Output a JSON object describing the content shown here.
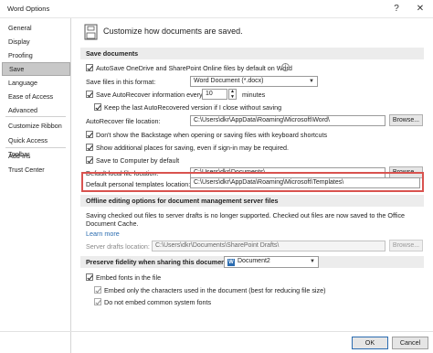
{
  "window": {
    "title": "Word Options",
    "help": "?",
    "close": "✕"
  },
  "sidebar": {
    "items": [
      {
        "label": "General"
      },
      {
        "label": "Display"
      },
      {
        "label": "Proofing"
      },
      {
        "label": "Save",
        "selected": true
      },
      {
        "label": "Language"
      },
      {
        "label": "Ease of Access"
      },
      {
        "label": "Advanced"
      },
      {
        "label": "Customize Ribbon"
      },
      {
        "label": "Quick Access Toolbar"
      },
      {
        "label": "Add-ins"
      },
      {
        "label": "Trust Center"
      }
    ]
  },
  "header": {
    "text": "Customize how documents are saved."
  },
  "save_documents": {
    "heading": "Save documents",
    "autosave": {
      "label": "AutoSave OneDrive and SharePoint Online files by default on Word",
      "checked": true
    },
    "format_label": "Save files in this format:",
    "format_value": "Word Document (*.docx)",
    "autorecover": {
      "label": "Save AutoRecover information every",
      "checked": true,
      "minutes": "10",
      "unit": "minutes"
    },
    "keep_last": {
      "label": "Keep the last AutoRecovered version if I close without saving",
      "checked": true
    },
    "autorecover_location_label": "AutoRecover file location:",
    "autorecover_location_value": "C:\\Users\\dkr\\AppData\\Roaming\\Microsoft\\Word\\",
    "browse_label": "Browse...",
    "backstage": {
      "label": "Don't show the Backstage when opening or saving files with keyboard shortcuts",
      "checked": true
    },
    "additional_places": {
      "label": "Show additional places for saving, even if sign-in may be required.",
      "checked": true
    },
    "save_to_computer": {
      "label": "Save to Computer by default",
      "checked": true
    },
    "default_local_label": "Default local file location:",
    "default_local_value": "C:\\Users\\dkr\\Documents\\",
    "default_templates_label": "Default personal templates location:",
    "default_templates_value": "C:\\Users\\dkr\\AppData\\Roaming\\Microsoft\\Templates\\"
  },
  "offline": {
    "heading": "Offline editing options for document management server files",
    "description": "Saving checked out files to server drafts is no longer supported. Checked out files are now saved to the Office Document Cache.",
    "learn_more": "Learn more",
    "drafts_label": "Server drafts location:",
    "drafts_value": "C:\\Users\\dkr\\Documents\\SharePoint Drafts\\",
    "browse_label": "Browse..."
  },
  "fidelity": {
    "heading": "Preserve fidelity when sharing this document:",
    "document": "Document2",
    "embed_fonts": {
      "label": "Embed fonts in the file",
      "checked": true
    },
    "embed_only_used": {
      "label": "Embed only the characters used in the document (best for reducing file size)",
      "checked": true
    },
    "no_common_fonts": {
      "label": "Do not embed common system fonts",
      "checked": true
    }
  },
  "footer": {
    "ok": "OK",
    "cancel": "Cancel"
  },
  "colors": {
    "highlight": "#d9534f",
    "link": "#2b6cb0",
    "selected_nav": "#c8c8c8"
  }
}
